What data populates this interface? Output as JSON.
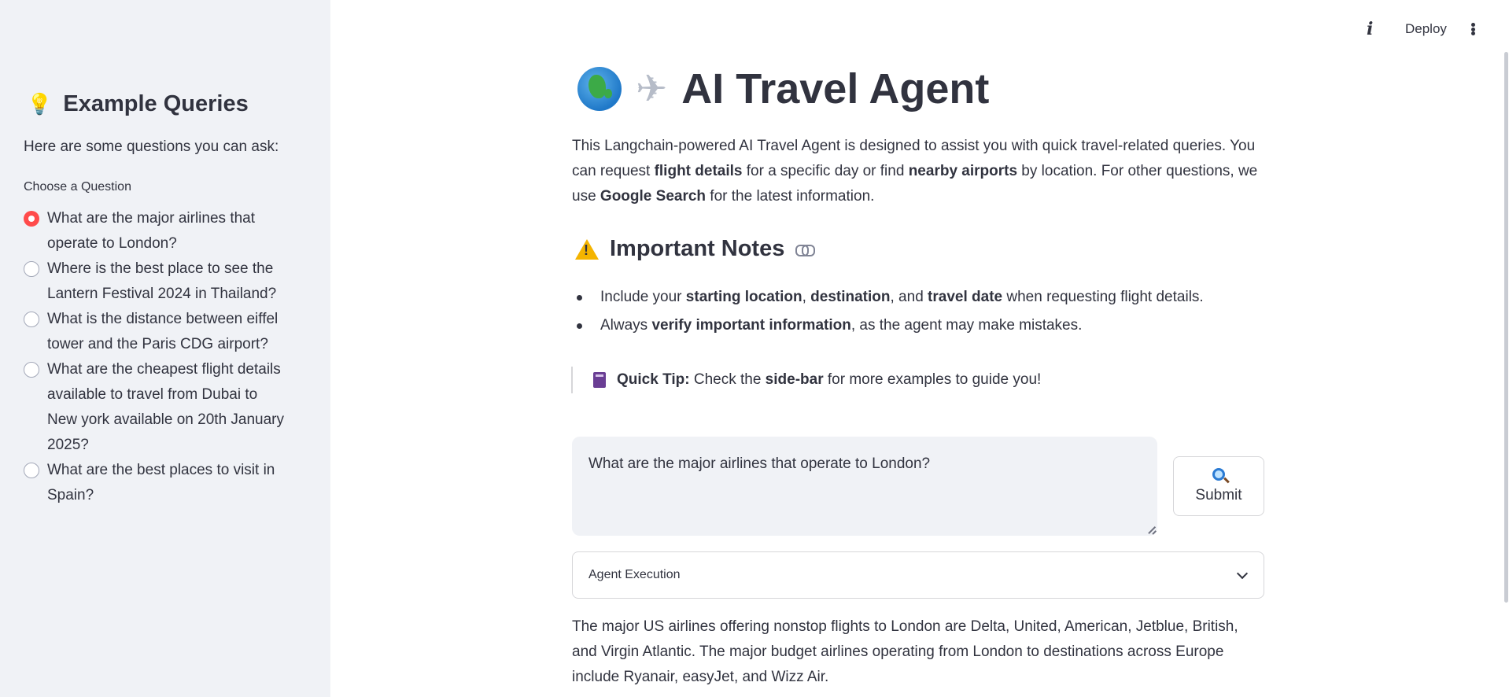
{
  "sidebar": {
    "header_icon": "lightbulb-icon",
    "header": "Example Queries",
    "intro": "Here are some questions you can ask:",
    "choose_label": "Choose a Question",
    "options": [
      {
        "label": "What are the major airlines that operate to London?",
        "selected": true
      },
      {
        "label": "Where is the best place to see the Lantern Festival 2024 in Thailand?",
        "selected": false
      },
      {
        "label": "What is the distance between eiffel tower and the Paris CDG airport?",
        "selected": false
      },
      {
        "label": "What are the cheapest flight details available to travel from Dubai to New york available on 20th January 2025?",
        "selected": false
      },
      {
        "label": "What are the best places to visit in Spain?",
        "selected": false
      }
    ]
  },
  "toolbar": {
    "info_icon": "info-icon",
    "deploy_label": "Deploy",
    "more_icon": "more-vertical-icon"
  },
  "main": {
    "title": "AI Travel Agent",
    "title_icons": [
      "globe-icon",
      "airplane-icon"
    ],
    "intro": {
      "t1": "This Langchain-powered AI Travel Agent is designed to assist you with quick travel-related queries. You can request ",
      "b1": "flight details",
      "t2": " for a specific day or find ",
      "b2": "nearby airports",
      "t3": " by location. For other questions, we use ",
      "b3": "Google Search",
      "t4": " for the latest information."
    },
    "notes_header": "Important Notes",
    "notes": {
      "n1": {
        "t1": "Include your ",
        "b1": "starting location",
        "t2": ", ",
        "b2": "destination",
        "t3": ", and ",
        "b3": "travel date",
        "t4": " when requesting flight details."
      },
      "n2": {
        "t1": "Always ",
        "b1": "verify important information",
        "t2": ", as the agent may make mistakes."
      }
    },
    "tip": {
      "label": "Quick Tip:",
      "t1": " Check the ",
      "b1": "side-bar",
      "t2": " for more examples to guide you!"
    },
    "query_value": "What are the major airlines that operate to London?",
    "submit_label": "Submit",
    "expander_label": "Agent Execution",
    "answer": "The major US airlines offering nonstop flights to London are Delta, United, American, Jetblue, British, and Virgin Atlantic. The major budget airlines operating from London to destinations across Europe include Ryanair, easyJet, and Wizz Air."
  },
  "colors": {
    "accent": "#ff4b4b",
    "sidebar_bg": "#f0f2f6",
    "text": "#31333f"
  }
}
